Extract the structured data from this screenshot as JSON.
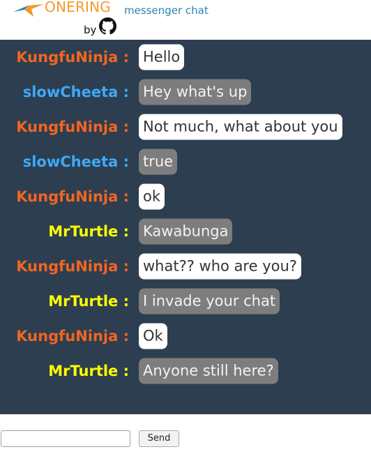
{
  "header": {
    "brand": "ONERING",
    "by": "by",
    "subtitle": "messenger chat",
    "brand_color": "#f39a2d",
    "subtitle_color": "#2a86a8",
    "github_icon": "github-icon"
  },
  "chat": {
    "background": "#2c3e50",
    "user_colors": {
      "KungfuNinja": "#f26522",
      "slowCheeta": "#3fa9f5",
      "MrTurtle": "#ffff00"
    },
    "messages": [
      {
        "user": "KungfuNinja :",
        "text": "Hello",
        "is_self": true
      },
      {
        "user": "slowCheeta :",
        "text": "Hey what's up",
        "is_self": false
      },
      {
        "user": "KungfuNinja :",
        "text": "Not much, what about you",
        "is_self": true
      },
      {
        "user": "slowCheeta :",
        "text": "true",
        "is_self": false
      },
      {
        "user": "KungfuNinja :",
        "text": "ok",
        "is_self": true
      },
      {
        "user": "MrTurtle :",
        "text": "Kawabunga",
        "is_self": false
      },
      {
        "user": "KungfuNinja :",
        "text": "what?? who are you?",
        "is_self": true
      },
      {
        "user": "MrTurtle :",
        "text": "I invade your chat",
        "is_self": false
      },
      {
        "user": "KungfuNinja :",
        "text": "Ok",
        "is_self": true
      },
      {
        "user": "MrTurtle :",
        "text": "Anyone still here?",
        "is_self": false
      }
    ]
  },
  "composer": {
    "input_value": "",
    "send_label": "Send"
  }
}
